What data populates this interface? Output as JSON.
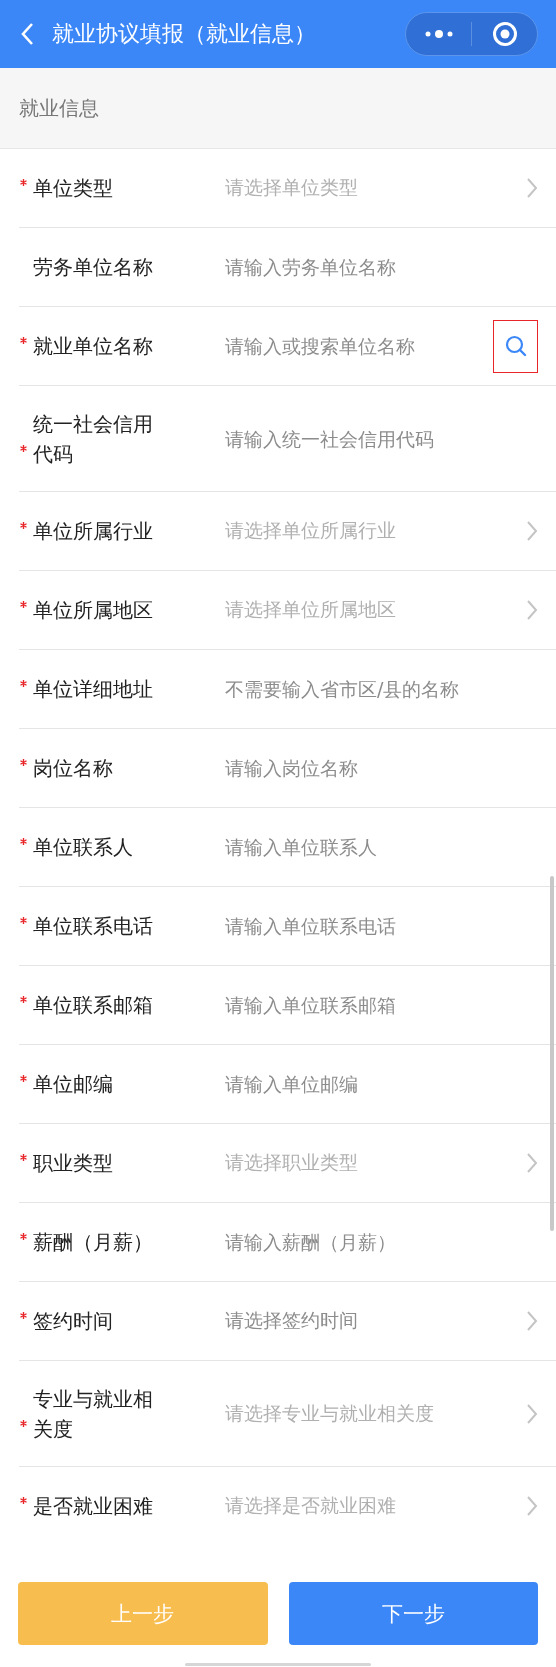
{
  "header": {
    "title": "就业协议填报（就业信息）"
  },
  "section": {
    "title": "就业信息"
  },
  "fields": [
    {
      "label": "单位类型",
      "required": true,
      "kind": "select",
      "placeholder": "请选择单位类型"
    },
    {
      "label": "劳务单位名称",
      "required": false,
      "kind": "input",
      "placeholder": "请输入劳务单位名称"
    },
    {
      "label": "就业单位名称",
      "required": true,
      "kind": "search",
      "placeholder": "请输入或搜索单位名称"
    },
    {
      "label": "统一社会信用代码",
      "required": true,
      "kind": "input",
      "placeholder": "请输入统一社会信用代码"
    },
    {
      "label": "单位所属行业",
      "required": true,
      "kind": "select",
      "placeholder": "请选择单位所属行业"
    },
    {
      "label": "单位所属地区",
      "required": true,
      "kind": "select",
      "placeholder": "请选择单位所属地区"
    },
    {
      "label": "单位详细地址",
      "required": true,
      "kind": "input",
      "placeholder": "不需要输入省市区/县的名称"
    },
    {
      "label": "岗位名称",
      "required": true,
      "kind": "input",
      "placeholder": "请输入岗位名称"
    },
    {
      "label": "单位联系人",
      "required": true,
      "kind": "input",
      "placeholder": "请输入单位联系人"
    },
    {
      "label": "单位联系电话",
      "required": true,
      "kind": "input",
      "placeholder": "请输入单位联系电话"
    },
    {
      "label": "单位联系邮箱",
      "required": true,
      "kind": "input",
      "placeholder": "请输入单位联系邮箱"
    },
    {
      "label": "单位邮编",
      "required": true,
      "kind": "input",
      "placeholder": "请输入单位邮编"
    },
    {
      "label": "职业类型",
      "required": true,
      "kind": "select",
      "placeholder": "请选择职业类型"
    },
    {
      "label": "薪酬（月薪）",
      "required": true,
      "kind": "input",
      "placeholder": "请输入薪酬（月薪）"
    },
    {
      "label": "签约时间",
      "required": true,
      "kind": "date",
      "placeholder": "请选择签约时间"
    },
    {
      "label": "专业与就业相关度",
      "required": true,
      "kind": "select",
      "placeholder": "请选择专业与就业相关度"
    },
    {
      "label": "是否就业困难",
      "required": true,
      "kind": "select",
      "placeholder": "请选择是否就业困难"
    }
  ],
  "buttons": {
    "previous": "上一步",
    "next": "下一步"
  }
}
